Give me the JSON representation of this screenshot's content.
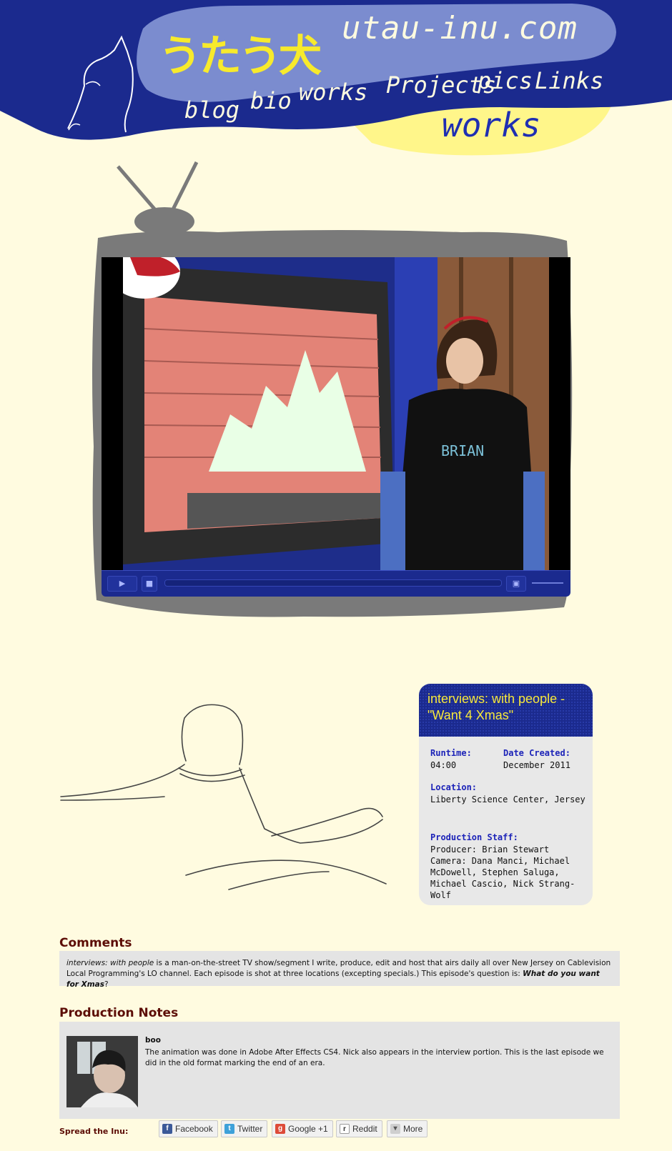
{
  "site": {
    "title": "utau-inu.com",
    "title_jp": "うたう犬",
    "section": "works"
  },
  "nav": {
    "blog": "blog",
    "bio": "bio",
    "works": "works",
    "projects": "Projects",
    "pics": "pics",
    "links": "Links"
  },
  "player": {
    "shirt_text": "BRIAN",
    "play_icon": "play-icon",
    "stop_icon": "stop-icon",
    "fullscreen_icon": "fullscreen-icon",
    "progress": 0.0
  },
  "info": {
    "title": "interviews: with people - \"Want 4 Xmas\"",
    "runtime_label": "Runtime:",
    "runtime": "04:00",
    "date_label": "Date Created:",
    "date": "December 2011",
    "location_label": "Location:",
    "location": "Liberty Science Center, Jersey Garden",
    "staff_label": "Production Staff:",
    "staff_line1": "Producer: Brian Stewart",
    "staff_line2": "Camera: Dana Manci, Michael McDowell, Stephen Saluga,  Michael Cascio, Nick Strang-Wolf"
  },
  "comments": {
    "heading": "Comments",
    "show_name": "interviews: with people",
    "text": " is a man-on-the-street TV show/segment I write, produce, edit and host that airs daily all over New Jersey on Cablevision Local Programming's LO channel. Each episode is shot at three locations (excepting specials.) This episode's question is: ",
    "question": "What do you want for Xmas",
    "tail": "?"
  },
  "notes": {
    "heading": "Production Notes",
    "author": "boo",
    "text": "The animation was done in Adobe After Effects CS4. Nick also appears in the interview portion. This is the last episode we did in the old format marking the end of an era."
  },
  "share": {
    "label": "Spread the Inu:",
    "facebook": "Facebook",
    "twitter": "Twitter",
    "google": "Google +1",
    "reddit": "Reddit",
    "more": "More"
  },
  "colors": {
    "background": "#fffbe0",
    "header_blue": "#1b2a8e",
    "header_cloud": "#7b8ccf",
    "accent_yellow": "#f7ea2c",
    "heading_red": "#5c0d06",
    "label_blue": "#1c23b8"
  }
}
